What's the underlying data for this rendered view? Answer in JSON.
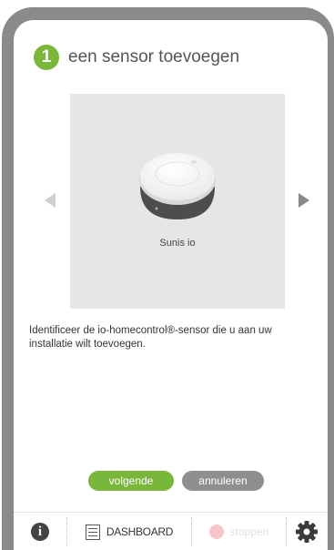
{
  "step": {
    "number": "1",
    "title": "een sensor toevoegen"
  },
  "carousel": {
    "device_name": "Sunis io",
    "prev_icon": "chevron-left-icon",
    "next_icon": "chevron-right-icon"
  },
  "description": "Identificeer de io-homecontrol®-sensor die u aan uw installatie wilt toevoegen.",
  "buttons": {
    "next_label": "volgende",
    "cancel_label": "annuleren"
  },
  "toolbar": {
    "info_glyph": "i",
    "dashboard_label": "DASHBOARD",
    "stop_label": "stoppen",
    "settings_icon": "gear-icon"
  },
  "colors": {
    "accent_green": "#79b73a",
    "frame_gray": "#8a8a8a",
    "stop_pink": "#f7c6ca"
  }
}
